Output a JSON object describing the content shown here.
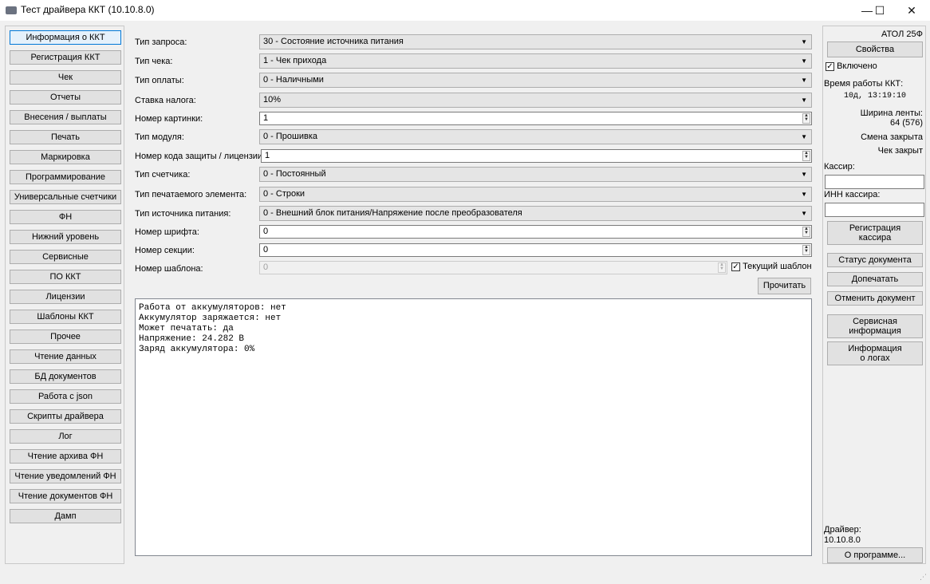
{
  "window": {
    "title": "Тест драйвера ККТ (10.10.8.0)",
    "minimize_glyph": "—",
    "maximize_glyph": "☐",
    "close_glyph": "✕"
  },
  "sidebar": {
    "items": [
      {
        "label": "Информация о ККТ",
        "active": true
      },
      {
        "label": "Регистрация ККТ"
      },
      {
        "label": "Чек"
      },
      {
        "label": "Отчеты"
      },
      {
        "label": "Внесения / выплаты"
      },
      {
        "label": "Печать"
      },
      {
        "label": "Маркировка"
      },
      {
        "label": "Программирование"
      },
      {
        "label": "Универсальные счетчики"
      },
      {
        "label": "ФН"
      },
      {
        "label": "Нижний уровень"
      },
      {
        "label": "Сервисные"
      },
      {
        "label": "ПО ККТ"
      },
      {
        "label": "Лицензии"
      },
      {
        "label": "Шаблоны ККТ"
      },
      {
        "label": "Прочее"
      },
      {
        "label": "Чтение данных"
      },
      {
        "label": "БД документов"
      },
      {
        "label": "Работа с json"
      },
      {
        "label": "Скрипты драйвера"
      },
      {
        "label": "Лог"
      },
      {
        "label": "Чтение архива ФН"
      },
      {
        "label": "Чтение уведомлений ФН"
      },
      {
        "label": "Чтение документов ФН"
      },
      {
        "label": "Дамп"
      }
    ]
  },
  "form": {
    "fields": [
      {
        "label": "Тип запроса:",
        "value": "30 - Состояние источника питания",
        "kind": "combo"
      },
      {
        "label": "Тип чека:",
        "value": "1 - Чек прихода",
        "kind": "combo"
      },
      {
        "label": "Тип оплаты:",
        "value": "0 - Наличными",
        "kind": "combo"
      },
      {
        "label": "Ставка налога:",
        "value": "10%",
        "kind": "combo"
      },
      {
        "label": "Номер картинки:",
        "value": "1",
        "kind": "spin"
      },
      {
        "label": "Тип модуля:",
        "value": "0 - Прошивка",
        "kind": "combo"
      },
      {
        "label": "Номер кода защиты / лицензии:",
        "value": "1",
        "kind": "spin"
      },
      {
        "label": "Тип счетчика:",
        "value": "0 - Постоянный",
        "kind": "combo"
      },
      {
        "label": "Тип печатаемого элемента:",
        "value": "0 - Строки",
        "kind": "combo"
      },
      {
        "label": "Тип источника питания:",
        "value": "0 - Внешний блок питания/Напряжение после преобразователя",
        "kind": "combo"
      },
      {
        "label": "Номер шрифта:",
        "value": "0",
        "kind": "spin"
      },
      {
        "label": "Номер секции:",
        "value": "0",
        "kind": "spin"
      },
      {
        "label": "Номер шаблона:",
        "value": "0",
        "kind": "spin-disabled"
      }
    ],
    "current_template_label": "Текущий шаблон",
    "current_template_checked": true,
    "read_button": "Прочитать",
    "output_lines": [
      "Работа от аккумуляторов: нет",
      "Аккумулятор заряжается: нет",
      "Может печатать: да",
      "Напряжение: 24.282 В",
      "Заряд аккумулятора: 0%"
    ]
  },
  "right_panel": {
    "model": "АТОЛ 25Ф",
    "properties_button": "Свойства",
    "enabled_label": "Включено",
    "enabled_checked": true,
    "uptime_label": "Время работы ККТ:",
    "uptime_value": "10д, 13:19:10",
    "tape_width_label": "Ширина ленты:",
    "tape_width_value": "64 (576)",
    "shift_status": "Смена закрыта",
    "receipt_status": "Чек закрыт",
    "cashier_label": "Кассир:",
    "cashier_value": "",
    "cashier_inn_label": "ИНН кассира:",
    "cashier_inn_value": "",
    "register_cashier_line1": "Регистрация",
    "register_cashier_line2": "кассира",
    "document_status_button": "Статус документа",
    "reprint_button": "Допечатать",
    "cancel_document_button": "Отменить документ",
    "service_info_line1": "Сервисная",
    "service_info_line2": "информация",
    "logs_info_line1": "Информация",
    "logs_info_line2": "о логах",
    "driver_label": "Драйвер:",
    "driver_version": "10.10.8.0",
    "about_button": "О программе..."
  }
}
